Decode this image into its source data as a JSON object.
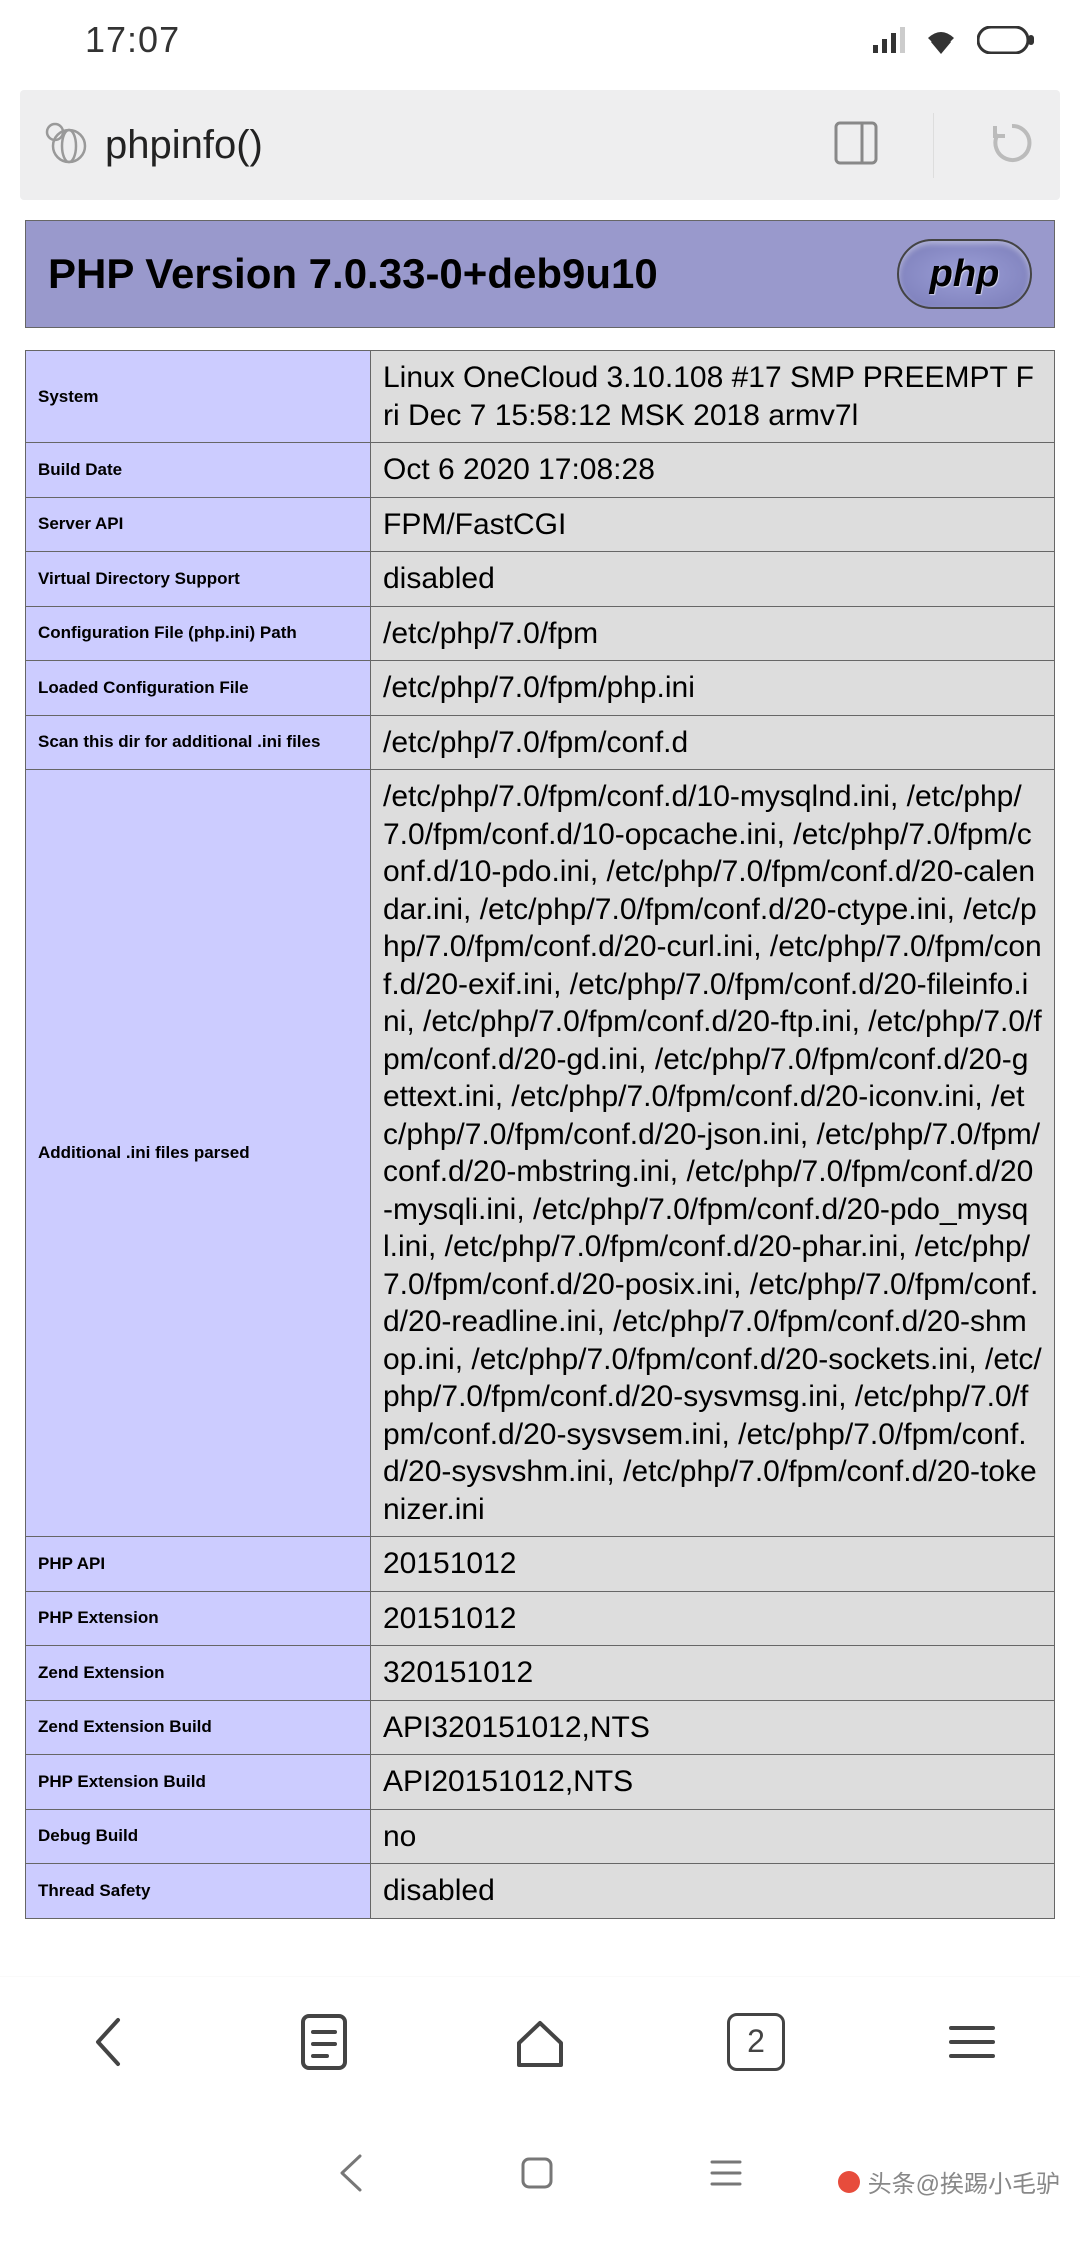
{
  "status": {
    "time": "17:07"
  },
  "browser": {
    "url": "phpinfo()",
    "tab_count": "2"
  },
  "php": {
    "version_heading": "PHP Version 7.0.33-0+deb9u10",
    "logo_text": "php"
  },
  "info_rows": [
    {
      "label": "System",
      "value": "Linux OneCloud 3.10.108 #17 SMP PREEMPT Fri Dec 7 15:58:12 MSK 2018 armv7l"
    },
    {
      "label": "Build Date",
      "value": "Oct 6 2020 17:08:28"
    },
    {
      "label": "Server API",
      "value": "FPM/FastCGI"
    },
    {
      "label": "Virtual Directory Support",
      "value": "disabled"
    },
    {
      "label": "Configuration File (php.ini) Path",
      "value": "/etc/php/7.0/fpm"
    },
    {
      "label": "Loaded Configuration File",
      "value": "/etc/php/7.0/fpm/php.ini"
    },
    {
      "label": "Scan this dir for additional .ini files",
      "value": "/etc/php/7.0/fpm/conf.d"
    },
    {
      "label": "Additional .ini files parsed",
      "value": "/etc/php/7.0/fpm/conf.d/10-mysqlnd.ini, /etc/php/7.0/fpm/conf.d/10-opcache.ini, /etc/php/7.0/fpm/conf.d/10-pdo.ini, /etc/php/7.0/fpm/conf.d/20-calendar.ini, /etc/php/7.0/fpm/conf.d/20-ctype.ini, /etc/php/7.0/fpm/conf.d/20-curl.ini, /etc/php/7.0/fpm/conf.d/20-exif.ini, /etc/php/7.0/fpm/conf.d/20-fileinfo.ini, /etc/php/7.0/fpm/conf.d/20-ftp.ini, /etc/php/7.0/fpm/conf.d/20-gd.ini, /etc/php/7.0/fpm/conf.d/20-gettext.ini, /etc/php/7.0/fpm/conf.d/20-iconv.ini, /etc/php/7.0/fpm/conf.d/20-json.ini, /etc/php/7.0/fpm/conf.d/20-mbstring.ini, /etc/php/7.0/fpm/conf.d/20-mysqli.ini, /etc/php/7.0/fpm/conf.d/20-pdo_mysql.ini, /etc/php/7.0/fpm/conf.d/20-phar.ini, /etc/php/7.0/fpm/conf.d/20-posix.ini, /etc/php/7.0/fpm/conf.d/20-readline.ini, /etc/php/7.0/fpm/conf.d/20-shmop.ini, /etc/php/7.0/fpm/conf.d/20-sockets.ini, /etc/php/7.0/fpm/conf.d/20-sysvmsg.ini, /etc/php/7.0/fpm/conf.d/20-sysvsem.ini, /etc/php/7.0/fpm/conf.d/20-sysvshm.ini, /etc/php/7.0/fpm/conf.d/20-tokenizer.ini"
    },
    {
      "label": "PHP API",
      "value": "20151012"
    },
    {
      "label": "PHP Extension",
      "value": "20151012"
    },
    {
      "label": "Zend Extension",
      "value": "320151012"
    },
    {
      "label": "Zend Extension Build",
      "value": "API320151012,NTS"
    },
    {
      "label": "PHP Extension Build",
      "value": "API20151012,NTS"
    },
    {
      "label": "Debug Build",
      "value": "no"
    },
    {
      "label": "Thread Safety",
      "value": "disabled"
    }
  ],
  "watermark": {
    "text": "头条@挨踢小毛驴"
  }
}
